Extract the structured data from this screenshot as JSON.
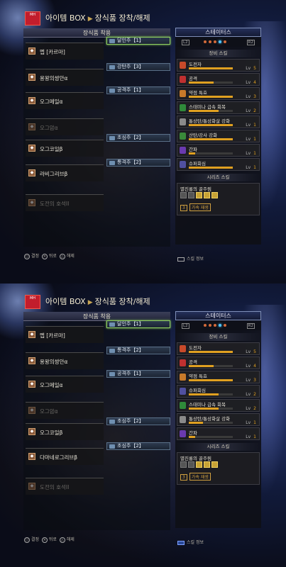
{
  "panels": [
    {
      "logo": "MONSTER HUNTER WORLD",
      "title": "아이템 BOX",
      "subtitle": "장식품 장착/해제",
      "left_header": "장식품 착용",
      "rows": [
        {
          "armor": "멥 [카르마]",
          "dim": false,
          "decos": [
            {
              "label": "달인주【1】",
              "sel": true
            }
          ]
        },
        {
          "armor": "용왕의쌍안α",
          "dim": false,
          "decos": [
            {
              "label": "강탄주【3】",
              "sel": false
            }
          ]
        },
        {
          "armor": "오그메일α",
          "dim": false,
          "decos": [
            {
              "label": "공격주【1】",
              "sel": false
            }
          ]
        },
        {
          "armor": "오그암α",
          "dim": true,
          "decos": []
        },
        {
          "armor": "오그코일β",
          "dim": false,
          "decos": [
            {
              "label": "초심주【2】",
              "sel": false
            }
          ]
        },
        {
          "armor": "라비그리브β",
          "dim": false,
          "decos": [
            {
              "label": "통격주【2】",
              "sel": false
            }
          ]
        },
        {
          "armor": "도전의 호석II",
          "dim": true,
          "decos": []
        }
      ],
      "footer": {
        "confirm": "결정",
        "back": "뒤로",
        "remove": "해제"
      },
      "status_header": "스테이터스",
      "tab_left": "L2",
      "tab_right": "R2",
      "skills_header": "장비 스킬",
      "skills": [
        {
          "name": "도전자",
          "lv": "Lv",
          "val": "5",
          "fill": 1.0,
          "color": "#c84a2a"
        },
        {
          "name": "공격",
          "lv": "Lv",
          "val": "4",
          "fill": 0.57,
          "color": "#c03030"
        },
        {
          "name": "약점 특효",
          "lv": "Lv",
          "val": "3",
          "fill": 1.0,
          "color": "#c87a2a"
        },
        {
          "name": "스태미나 급속 회복",
          "lv": "Lv",
          "val": "2",
          "fill": 0.67,
          "color": "#2f8a3a"
        },
        {
          "name": "통상탄/통상화살 강화",
          "lv": "Lv",
          "val": "1",
          "fill": 1.0,
          "color": "#8a8a8a"
        },
        {
          "name": "산탄/강사 강화",
          "lv": "Lv",
          "val": "1",
          "fill": 1.0,
          "color": "#3a8a3a"
        },
        {
          "name": "간파",
          "lv": "Lv",
          "val": "1",
          "fill": 0.14,
          "color": "#6a3ab0"
        },
        {
          "name": "슈퍼회심",
          "lv": "Lv",
          "val": "1",
          "fill": 1.0,
          "color": "#5050a0"
        }
      ],
      "set_header": "시리즈 스킬",
      "set_name": "멸진룡의 골주림",
      "set_pieces": [
        0,
        0,
        1,
        1,
        1
      ],
      "set_bonus": {
        "count": "3",
        "name": "가속 재생"
      },
      "info": "스킬 정보"
    },
    {
      "logo": "MONSTER HUNTER WORLD",
      "title": "아이템 BOX",
      "subtitle": "장식품 장착/해제",
      "left_header": "장식품 착용",
      "rows": [
        {
          "armor": "멥 [카르마]",
          "dim": false,
          "decos": [
            {
              "label": "달인주【1】",
              "sel": true
            }
          ]
        },
        {
          "armor": "용왕의쌍안α",
          "dim": false,
          "decos": [
            {
              "label": "통격주【2】",
              "sel": false
            }
          ]
        },
        {
          "armor": "오그메일α",
          "dim": false,
          "decos": [
            {
              "label": "공격주【1】",
              "sel": false
            }
          ]
        },
        {
          "armor": "오그암α",
          "dim": true,
          "decos": []
        },
        {
          "armor": "오그코일β",
          "dim": false,
          "decos": [
            {
              "label": "초심주【2】",
              "sel": false
            }
          ]
        },
        {
          "armor": "다마네로그리브β",
          "dim": false,
          "decos": [
            {
              "label": "초심주【2】",
              "sel": false
            }
          ]
        },
        {
          "armor": "도전의 호석II",
          "dim": true,
          "decos": []
        }
      ],
      "footer": {
        "confirm": "결정",
        "back": "뒤로",
        "remove": "해제"
      },
      "status_header": "스테이터스",
      "tab_left": "L2",
      "tab_right": "R2",
      "skills_header": "장비 스킬",
      "skills": [
        {
          "name": "도전자",
          "lv": "Lv",
          "val": "5",
          "fill": 1.0,
          "color": "#c84a2a"
        },
        {
          "name": "공격",
          "lv": "Lv",
          "val": "4",
          "fill": 0.57,
          "color": "#c03030"
        },
        {
          "name": "약점 특효",
          "lv": "Lv",
          "val": "3",
          "fill": 1.0,
          "color": "#c87a2a"
        },
        {
          "name": "슈퍼회심",
          "lv": "Lv",
          "val": "2",
          "fill": 0.67,
          "color": "#5050a0"
        },
        {
          "name": "스태미나 급속 회복",
          "lv": "Lv",
          "val": "2",
          "fill": 0.67,
          "color": "#2f8a3a"
        },
        {
          "name": "통상탄/통상화살 강화",
          "lv": "Lv",
          "val": "1",
          "fill": 0.33,
          "color": "#8a8a8a"
        },
        {
          "name": "간파",
          "lv": "Lv",
          "val": "1",
          "fill": 0.14,
          "color": "#6a3ab0"
        }
      ],
      "set_header": "시리즈 스킬",
      "set_name": "멸진룡의 골주림",
      "set_pieces": [
        0,
        0,
        1,
        1,
        1
      ],
      "set_bonus": {
        "count": "3",
        "name": "가속 재생"
      },
      "info": "스킬 정보"
    }
  ]
}
